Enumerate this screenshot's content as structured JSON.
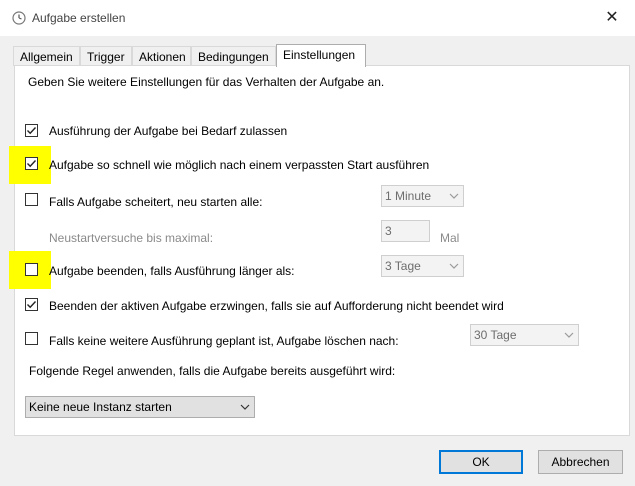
{
  "window": {
    "title": "Aufgabe erstellen",
    "icon": "clock-icon",
    "close_glyph": "✕"
  },
  "tabs": [
    {
      "label": "Allgemein",
      "active": false
    },
    {
      "label": "Trigger",
      "active": false
    },
    {
      "label": "Aktionen",
      "active": false
    },
    {
      "label": "Bedingungen",
      "active": false
    },
    {
      "label": "Einstellungen",
      "active": true
    }
  ],
  "settings": {
    "intro": "Geben Sie weitere Einstellungen für das Verhalten der Aufgabe an.",
    "allow_on_demand": {
      "label": "Ausführung der Aufgabe bei Bedarf zulassen",
      "checked": true
    },
    "run_after_missed": {
      "label": "Aufgabe so schnell wie möglich nach einem verpassten Start ausführen",
      "checked": true
    },
    "restart_on_failure": {
      "label": "Falls Aufgabe scheitert, neu starten alle:",
      "checked": false,
      "interval": "1 Minute"
    },
    "restart_attempts": {
      "label": "Neustartversuche bis maximal:",
      "value": "3",
      "unit": "Mal"
    },
    "stop_if_longer": {
      "label": "Aufgabe beenden, falls Ausführung länger als:",
      "checked": false,
      "duration": "3 Tage"
    },
    "force_stop": {
      "label": "Beenden der aktiven Aufgabe erzwingen, falls sie auf Aufforderung nicht beendet wird",
      "checked": true
    },
    "delete_if_not_scheduled": {
      "label": "Falls keine weitere Ausführung geplant ist, Aufgabe löschen nach:",
      "checked": false,
      "duration": "30 Tage"
    },
    "rule_label": "Folgende Regel anwenden, falls die Aufgabe bereits ausgeführt wird:",
    "rule_value": "Keine neue Instanz starten"
  },
  "buttons": {
    "ok": "OK",
    "cancel": "Abbrechen"
  },
  "colors": {
    "highlight": "#ffff00",
    "accent": "#0078d7"
  }
}
